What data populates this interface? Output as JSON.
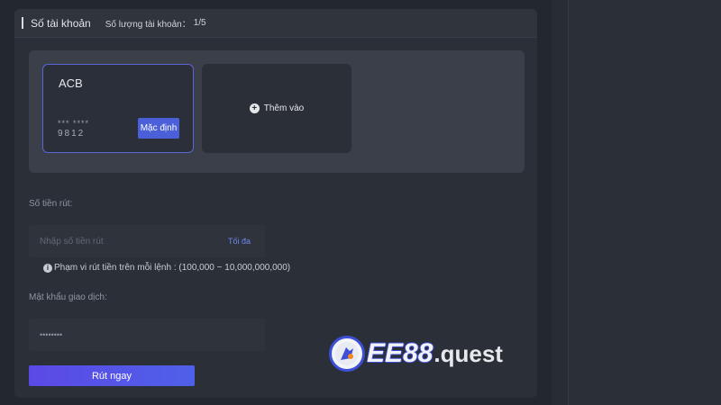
{
  "header": {
    "title": "Số tài khoản",
    "count_label": "Số lượng tài khoản：",
    "count_value": "1/5"
  },
  "cards": {
    "bank_name": "ACB",
    "masked": "***  ****",
    "last_digits": "9812",
    "default_label": "Mặc định",
    "add_label": "Thêm vào"
  },
  "amount": {
    "label": "Số tiền rút:",
    "placeholder": "Nhập số tiền rút",
    "max_label": "Tối đa",
    "range_text": "Phạm vi rút tiền trên mỗi lệnh : (100,000 ~ 10,000,000,000)"
  },
  "password": {
    "label": "Mật khẩu giao dịch:",
    "value": "••••••••"
  },
  "submit_label": "Rút ngay",
  "watermark": {
    "brand": "EE88",
    "suffix": ".quest"
  },
  "colors": {
    "accent": "#4a5fd8",
    "link": "#6e86f0",
    "panel": "#2b2f38"
  }
}
